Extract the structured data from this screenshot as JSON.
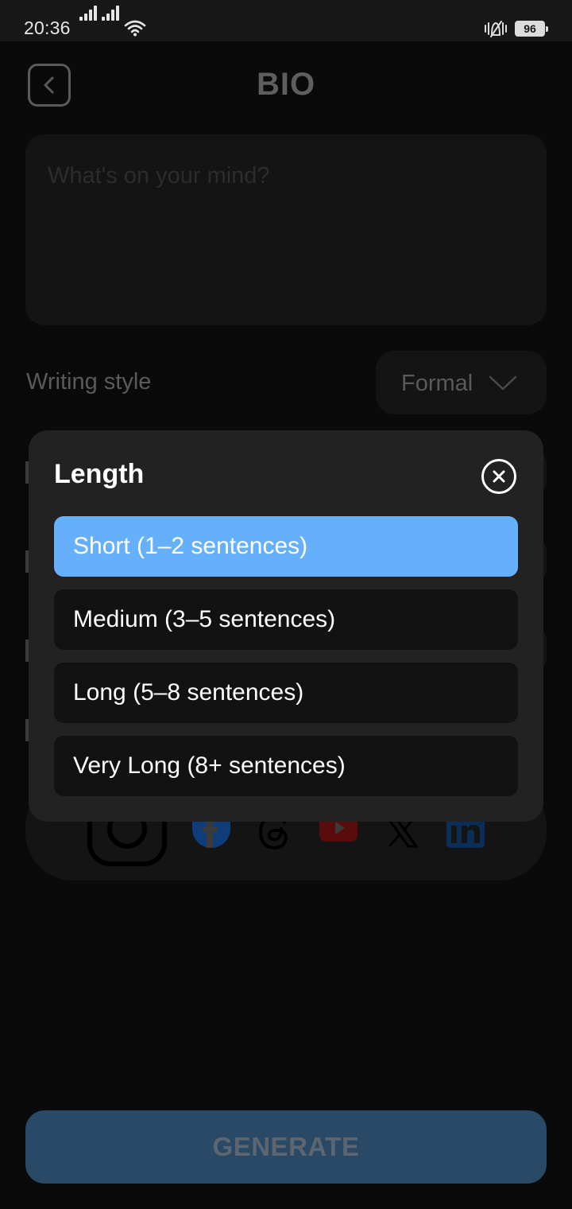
{
  "status_bar": {
    "time": "20:36",
    "battery": "96",
    "icons": [
      "signal-icon",
      "signal-icon",
      "wifi-icon",
      "vibrate-icon",
      "battery-icon"
    ]
  },
  "header": {
    "title": "BIO",
    "back_icon": "chevron-left-icon"
  },
  "composer": {
    "placeholder": "What's on your mind?"
  },
  "writing_style": {
    "label": "Writing style",
    "value": "Formal",
    "icon": "chevron-down-icon"
  },
  "social_platforms": [
    "instagram-icon",
    "facebook-icon",
    "threads-icon",
    "youtube-icon",
    "x-icon",
    "linkedin-icon"
  ],
  "generate_button": {
    "label": "GENERATE"
  },
  "length_modal": {
    "title": "Length",
    "close_icon": "close-circle-icon",
    "selected_index": 0,
    "options": [
      {
        "label": "Short (1–2 sentences)"
      },
      {
        "label": "Medium (3–5 sentences)"
      },
      {
        "label": "Long (5–8 sentences)"
      },
      {
        "label": "Very Long (8+ sentences)"
      }
    ]
  },
  "colors": {
    "background": "#0a0a0a",
    "modal": "#222222",
    "selected_option": "#66b0fb",
    "generate_button": "#2a4966"
  }
}
